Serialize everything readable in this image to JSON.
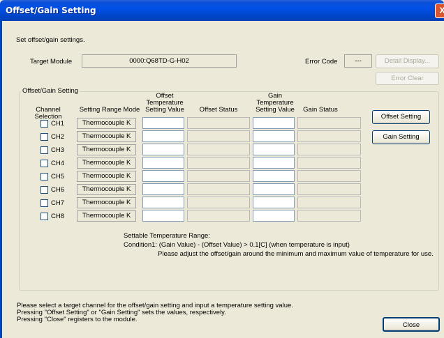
{
  "window": {
    "title": "Offset/Gain Setting",
    "close_glyph": "X"
  },
  "intro_text": "Set offset/gain settings.",
  "target_module": {
    "label": "Target Module",
    "value": "0000:Q68TD-G-H02"
  },
  "error_code": {
    "label": "Error Code",
    "value": "---"
  },
  "buttons": {
    "detail_display": "Detail Display...",
    "error_clear": "Error Clear",
    "offset_setting": "Offset Setting",
    "gain_setting": "Gain Setting",
    "close": "Close"
  },
  "group": {
    "label": "Offset/Gain Setting",
    "headers": {
      "channel_selection": "Channel Selection",
      "setting_range_mode": "Setting Range Mode",
      "offset_temp_1": "Offset",
      "offset_temp_2": "Temperature",
      "offset_temp_3": "Setting Value",
      "offset_status": "Offset Status",
      "gain_temp_1": "Gain",
      "gain_temp_2": "Temperature",
      "gain_temp_3": "Setting Value",
      "gain_status": "Gain Status"
    },
    "channels": [
      {
        "label": "CH1",
        "mode": "Thermocouple K",
        "offset_value": "",
        "offset_status": "",
        "gain_value": "",
        "gain_status": "",
        "checked": false
      },
      {
        "label": "CH2",
        "mode": "Thermocouple K",
        "offset_value": "",
        "offset_status": "",
        "gain_value": "",
        "gain_status": "",
        "checked": false
      },
      {
        "label": "CH3",
        "mode": "Thermocouple K",
        "offset_value": "",
        "offset_status": "",
        "gain_value": "",
        "gain_status": "",
        "checked": false
      },
      {
        "label": "CH4",
        "mode": "Thermocouple K",
        "offset_value": "",
        "offset_status": "",
        "gain_value": "",
        "gain_status": "",
        "checked": false
      },
      {
        "label": "CH5",
        "mode": "Thermocouple K",
        "offset_value": "",
        "offset_status": "",
        "gain_value": "",
        "gain_status": "",
        "checked": false
      },
      {
        "label": "CH6",
        "mode": "Thermocouple K",
        "offset_value": "",
        "offset_status": "",
        "gain_value": "",
        "gain_status": "",
        "checked": false
      },
      {
        "label": "CH7",
        "mode": "Thermocouple K",
        "offset_value": "",
        "offset_status": "",
        "gain_value": "",
        "gain_status": "",
        "checked": false
      },
      {
        "label": "CH8",
        "mode": "Thermocouple K",
        "offset_value": "",
        "offset_status": "",
        "gain_value": "",
        "gain_status": "",
        "checked": false
      }
    ],
    "range_info": {
      "line1": "Settable Temperature Range:",
      "line2": "Condition1: (Gain Value) - (Offset Value) > 0.1[C] (when temperature is input)",
      "line3": "Please adjust the offset/gain around the minimum and maximum value of temperature for use."
    }
  },
  "footer": {
    "line1": "Please select a target channel for the offset/gain setting and input a temperature setting value.",
    "line2": "Pressing \"Offset Setting\" or \"Gain Setting\" sets the values, respectively.",
    "line3": "Pressing \"Close\" registers to the module."
  }
}
